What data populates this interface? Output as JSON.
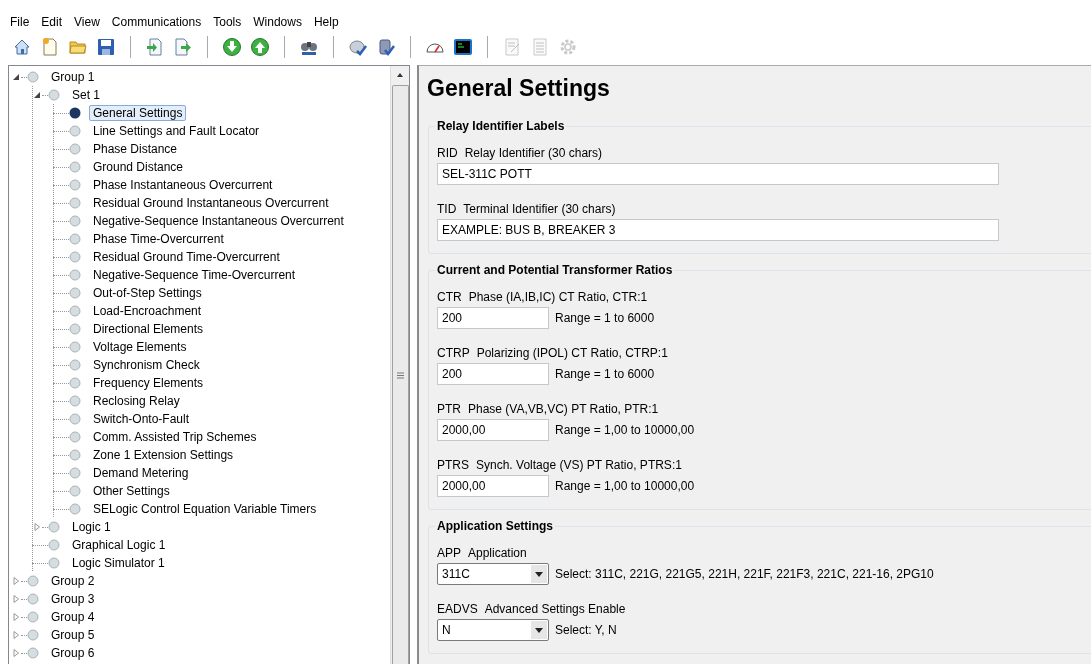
{
  "menu": [
    {
      "label": "File"
    },
    {
      "label": "Edit"
    },
    {
      "label": "View"
    },
    {
      "label": "Communications"
    },
    {
      "label": "Tools"
    },
    {
      "label": "Windows"
    },
    {
      "label": "Help"
    }
  ],
  "toolbar": [
    {
      "kind": "home",
      "disabled": false
    },
    {
      "kind": "new",
      "disabled": false
    },
    {
      "kind": "folder",
      "disabled": false
    },
    {
      "kind": "save",
      "disabled": false
    },
    {
      "kind": "separator"
    },
    {
      "kind": "import",
      "disabled": false
    },
    {
      "kind": "export",
      "disabled": false
    },
    {
      "kind": "separator"
    },
    {
      "kind": "down",
      "disabled": false
    },
    {
      "kind": "up",
      "disabled": false
    },
    {
      "kind": "separator"
    },
    {
      "kind": "binoculars",
      "disabled": false
    },
    {
      "kind": "separator"
    },
    {
      "kind": "disc",
      "disabled": false
    },
    {
      "kind": "database",
      "disabled": false
    },
    {
      "kind": "separator"
    },
    {
      "kind": "gauge",
      "disabled": false
    },
    {
      "kind": "terminal",
      "disabled": false
    },
    {
      "kind": "separator"
    },
    {
      "kind": "edit",
      "disabled": true
    },
    {
      "kind": "list",
      "disabled": true
    },
    {
      "kind": "gear",
      "disabled": true
    }
  ],
  "tree": [
    {
      "label": "Group 1",
      "selected": false,
      "expanded": true,
      "children": [
        {
          "label": "Set 1",
          "selected": false,
          "expanded": true,
          "children": [
            {
              "label": "General Settings",
              "selected": true
            },
            {
              "label": "Line Settings and Fault Locator",
              "selected": false
            },
            {
              "label": "Phase Distance",
              "selected": false
            },
            {
              "label": "Ground Distance",
              "selected": false
            },
            {
              "label": "Phase Instantaneous Overcurrent",
              "selected": false
            },
            {
              "label": "Residual Ground Instantaneous Overcurrent",
              "selected": false
            },
            {
              "label": "Negative-Sequence Instantaneous Overcurrent",
              "selected": false
            },
            {
              "label": "Phase Time-Overcurrent",
              "selected": false
            },
            {
              "label": "Residual Ground Time-Overcurrent",
              "selected": false
            },
            {
              "label": "Negative-Sequence Time-Overcurrent",
              "selected": false
            },
            {
              "label": "Out-of-Step Settings",
              "selected": false
            },
            {
              "label": "Load-Encroachment",
              "selected": false
            },
            {
              "label": "Directional Elements",
              "selected": false
            },
            {
              "label": "Voltage Elements",
              "selected": false
            },
            {
              "label": "Synchronism Check",
              "selected": false
            },
            {
              "label": "Frequency Elements",
              "selected": false
            },
            {
              "label": "Reclosing Relay",
              "selected": false
            },
            {
              "label": "Switch-Onto-Fault",
              "selected": false
            },
            {
              "label": "Comm. Assisted Trip Schemes",
              "selected": false
            },
            {
              "label": "Zone 1 Extension Settings",
              "selected": false
            },
            {
              "label": "Demand Metering",
              "selected": false
            },
            {
              "label": "Other Settings",
              "selected": false
            },
            {
              "label": "SELogic Control Equation Variable Timers",
              "selected": false
            }
          ]
        },
        {
          "label": "Logic 1",
          "selected": false,
          "expanded": false
        },
        {
          "label": "Graphical Logic 1",
          "selected": false
        },
        {
          "label": "Logic Simulator 1",
          "selected": false
        }
      ]
    },
    {
      "label": "Group 2",
      "selected": false,
      "expanded": false
    },
    {
      "label": "Group 3",
      "selected": false,
      "expanded": false
    },
    {
      "label": "Group 4",
      "selected": false,
      "expanded": false
    },
    {
      "label": "Group 5",
      "selected": false,
      "expanded": false
    },
    {
      "label": "Group 6",
      "selected": false,
      "expanded": false
    }
  ],
  "page": {
    "title": "General Settings",
    "sections": [
      {
        "title": "Relay Identifier Labels",
        "settings": [
          {
            "kind": "text",
            "code": "RID",
            "label": "Relay Identifier (30 chars)",
            "value": "SEL-311C POTT"
          },
          {
            "kind": "text",
            "code": "TID",
            "label": "Terminal Identifier (30 chars)",
            "value": "EXAMPLE: BUS B, BREAKER 3"
          }
        ]
      },
      {
        "title": "Current and Potential Transformer Ratios",
        "settings": [
          {
            "kind": "number",
            "code": "CTR",
            "label": "Phase (IA,IB,IC) CT Ratio, CTR:1",
            "value": "200",
            "hint": "Range = 1 to 6000"
          },
          {
            "kind": "number",
            "code": "CTRP",
            "label": "Polarizing (IPOL) CT Ratio, CTRP:1",
            "value": "200",
            "hint": "Range = 1 to 6000"
          },
          {
            "kind": "number",
            "code": "PTR",
            "label": "Phase (VA,VB,VC) PT Ratio, PTR:1",
            "value": "2000,00",
            "hint": "Range = 1,00 to 10000,00"
          },
          {
            "kind": "number",
            "code": "PTRS",
            "label": "Synch. Voltage (VS) PT Ratio, PTRS:1",
            "value": "2000,00",
            "hint": "Range = 1,00 to 10000,00"
          }
        ]
      },
      {
        "title": "Application Settings",
        "settings": [
          {
            "kind": "select",
            "code": "APP",
            "label": "Application",
            "value": "311C",
            "hint": "Select: 311C, 221G, 221G5, 221H, 221F, 221F3, 221C, 221-16, 2PG10"
          },
          {
            "kind": "select",
            "code": "EADVS",
            "label": "Advanced Settings Enable",
            "value": "N",
            "hint": "Select: Y, N"
          }
        ]
      }
    ]
  }
}
